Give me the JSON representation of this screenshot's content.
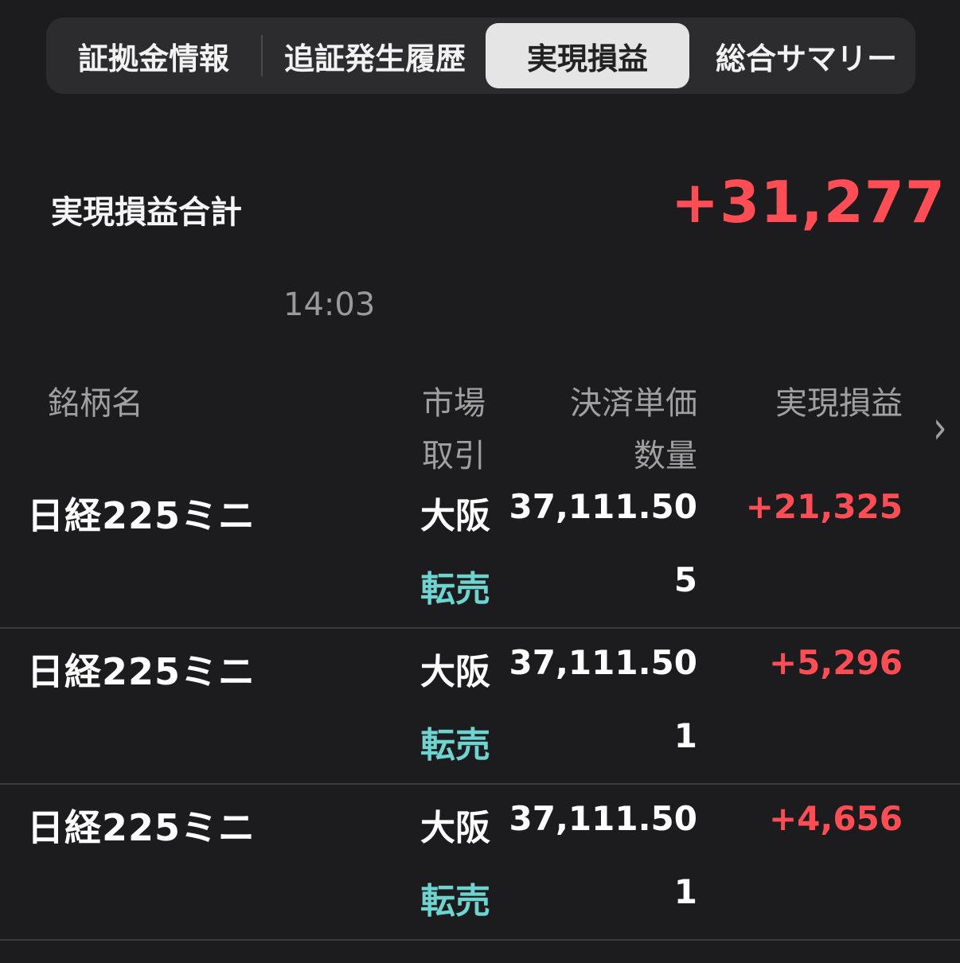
{
  "tabs": [
    {
      "label": "証拠金情報",
      "active": false
    },
    {
      "label": "追証発生履歴",
      "active": false
    },
    {
      "label": "実現損益",
      "active": true
    },
    {
      "label": "総合サマリー",
      "active": false
    }
  ],
  "summary": {
    "label": "実現損益合計",
    "value": "+31,277",
    "time": "14:03"
  },
  "table": {
    "headers": {
      "name": "銘柄名",
      "market": "市場",
      "trade": "取引",
      "price": "決済単価",
      "qty": "数量",
      "pnl": "実現損益"
    },
    "rows": [
      {
        "name": "日経225ミニ",
        "market": "大阪",
        "trade": "転売",
        "price": "37,111.50",
        "qty": "5",
        "pnl": "+21,325"
      },
      {
        "name": "日経225ミニ",
        "market": "大阪",
        "trade": "転売",
        "price": "37,111.50",
        "qty": "1",
        "pnl": "+5,296"
      },
      {
        "name": "日経225ミニ",
        "market": "大阪",
        "trade": "転売",
        "price": "37,111.50",
        "qty": "1",
        "pnl": "+4,656"
      }
    ]
  },
  "colors": {
    "background": "#1c1c1e",
    "profit": "#ff4d55",
    "trade": "#6fd3d0",
    "active_tab": "#e5e5e5"
  },
  "icons": {
    "scroll_right": "chevron-right-icon"
  }
}
